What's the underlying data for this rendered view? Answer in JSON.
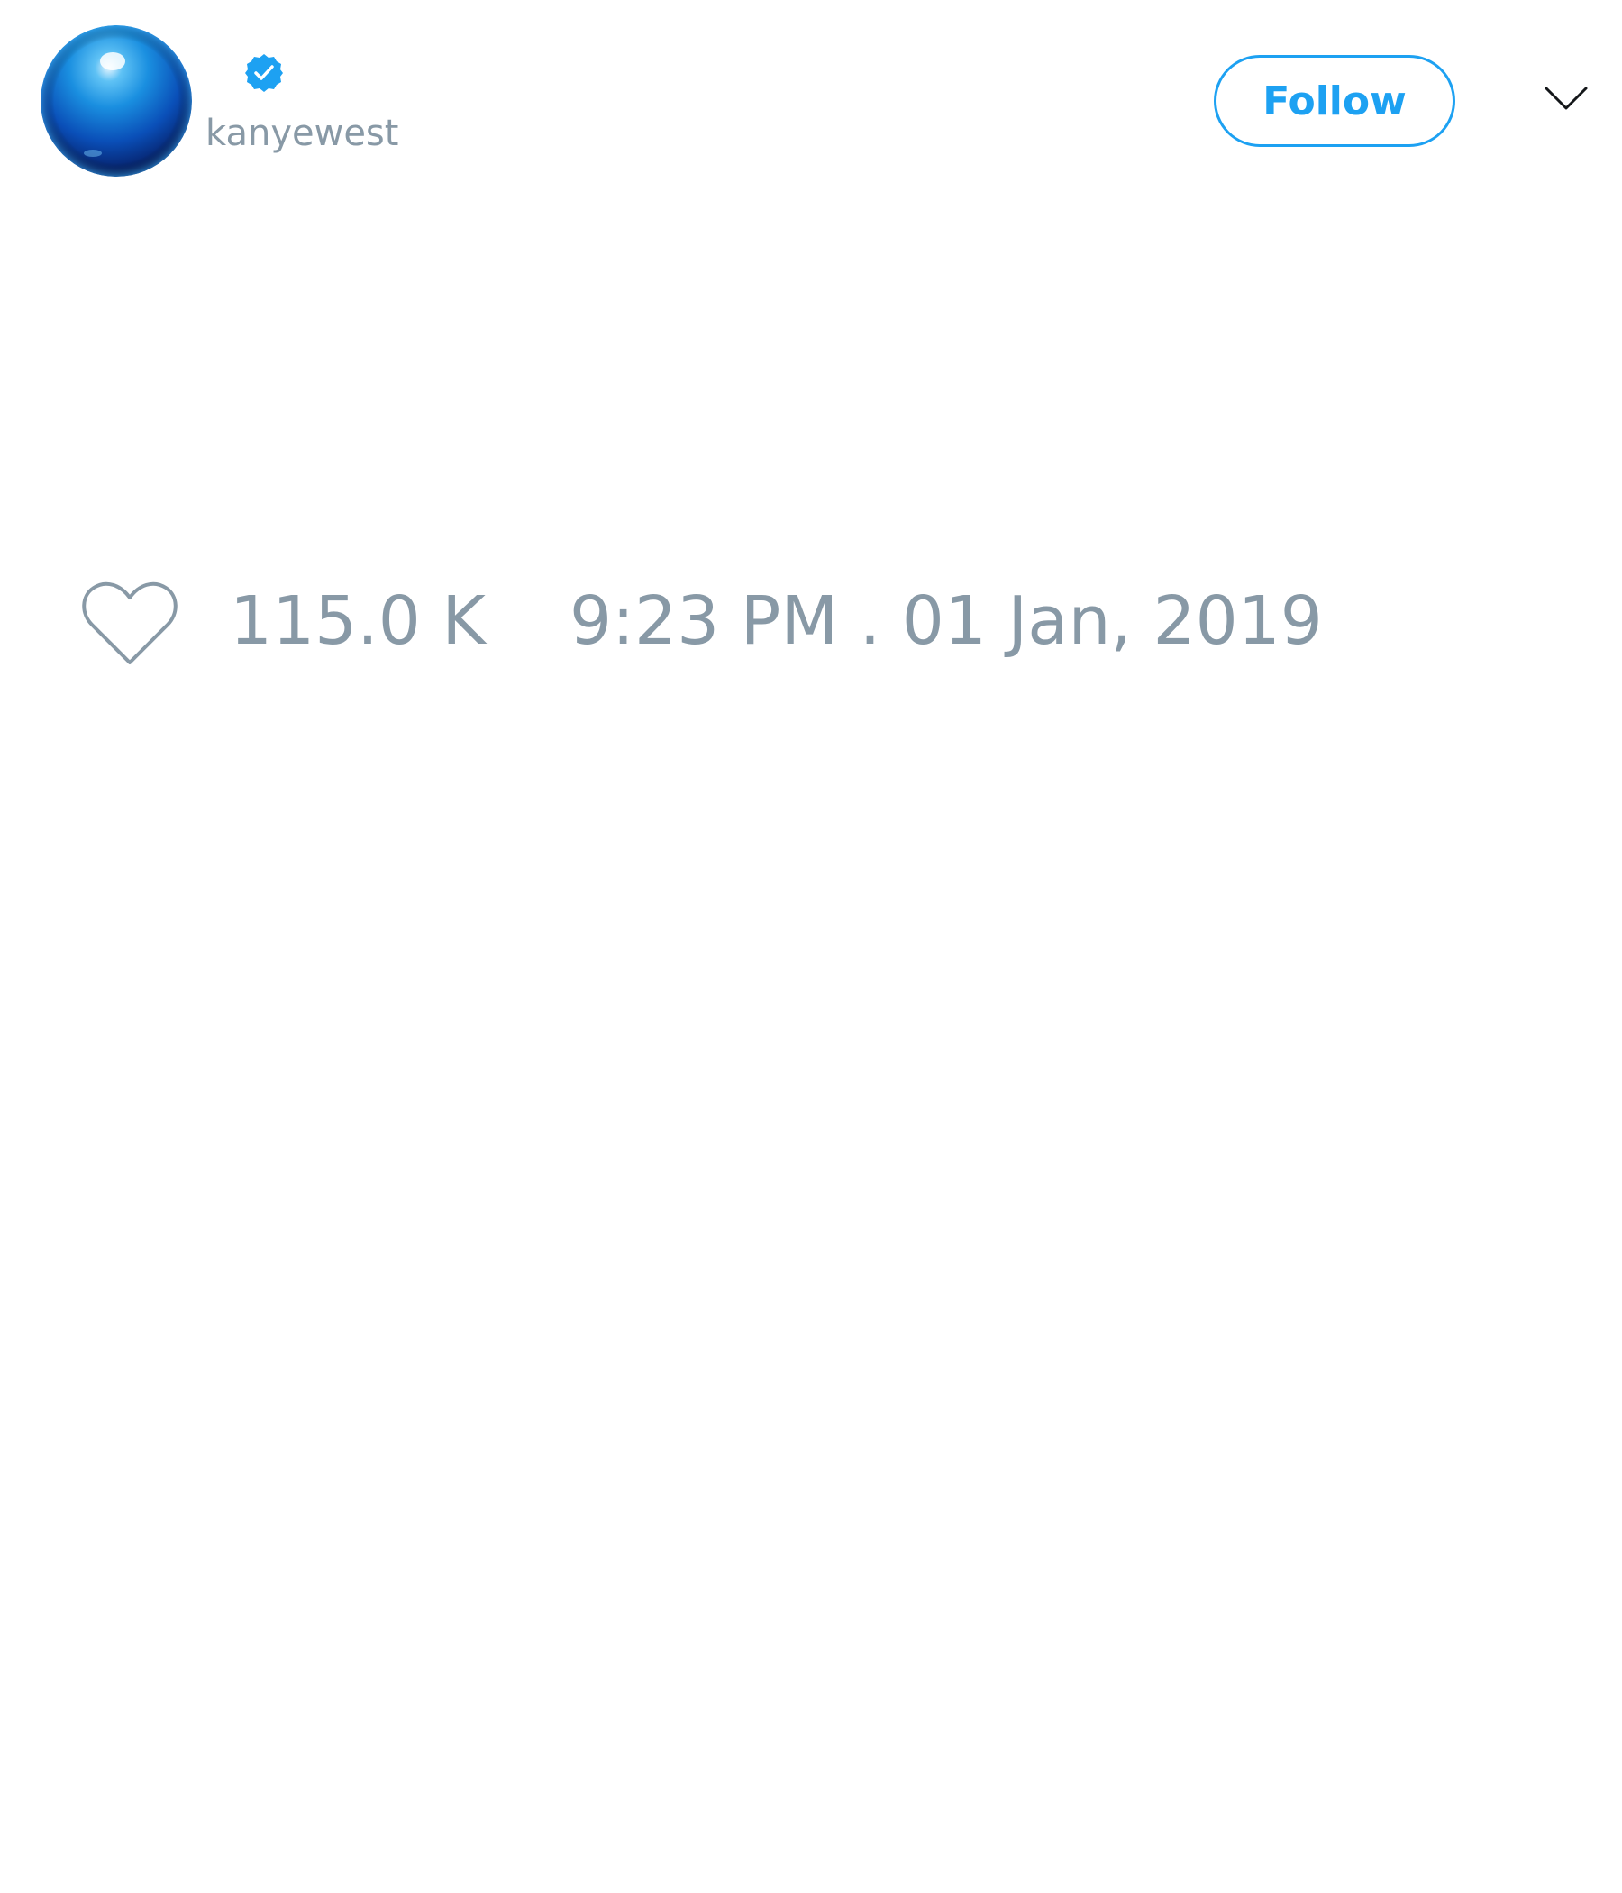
{
  "tweet": {
    "author": {
      "handle": "kanyewest",
      "verified": true,
      "avatar_icon": "blue-sphere-avatar"
    },
    "header": {
      "follow_label": "Follow",
      "menu_icon": "chevron-down-icon",
      "verified_icon": "verified-badge-icon"
    },
    "footer": {
      "like_icon": "heart-icon",
      "like_count": "115.0 K",
      "timestamp": "9:23 PM . 01 Jan, 2019"
    }
  },
  "colors": {
    "accent": "#1da1f2",
    "muted_text": "#8899a6",
    "background": "#ffffff"
  }
}
